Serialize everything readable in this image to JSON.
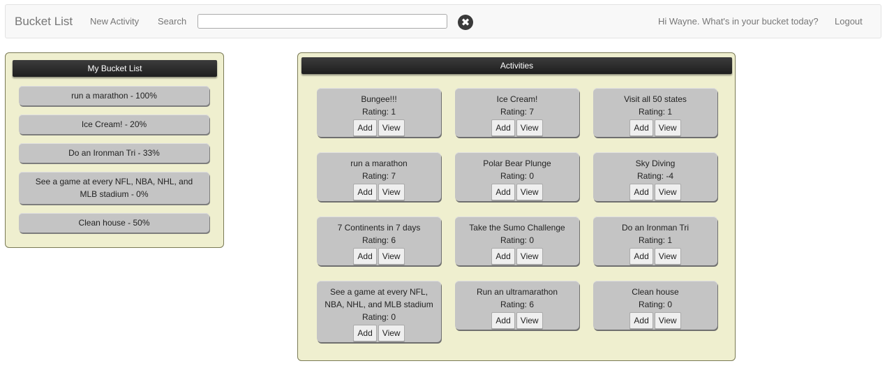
{
  "navbar": {
    "brand": "Bucket List",
    "new_activity": "New Activity",
    "search_label": "Search",
    "search_value": "",
    "clear_symbol": "✖",
    "greeting": "Hi Wayne. What's in your bucket today?",
    "logout": "Logout"
  },
  "bucket_list": {
    "title": "My Bucket List",
    "items": [
      "run a marathon - 100%",
      "Ice Cream! - 20%",
      "Do an Ironman Tri - 33%",
      "See a game at every NFL, NBA, NHL, and MLB stadium - 0%",
      "Clean house - 50%"
    ]
  },
  "activities": {
    "title": "Activities",
    "add_label": "Add",
    "view_label": "View",
    "items": [
      {
        "name": "Bungee!!!",
        "rating": "Rating: 1"
      },
      {
        "name": "Ice Cream!",
        "rating": "Rating: 7"
      },
      {
        "name": "Visit all 50 states",
        "rating": "Rating: 1"
      },
      {
        "name": "run a marathon",
        "rating": "Rating: 7"
      },
      {
        "name": "Polar Bear Plunge",
        "rating": "Rating: 0"
      },
      {
        "name": "Sky Diving",
        "rating": "Rating: -4"
      },
      {
        "name": "7 Continents in 7 days",
        "rating": "Rating: 6"
      },
      {
        "name": "Take the Sumo Challenge",
        "rating": "Rating: 0"
      },
      {
        "name": "Do an Ironman Tri",
        "rating": "Rating: 1"
      },
      {
        "name": "See a game at every NFL, NBA, NHL, and MLB stadium",
        "rating": "Rating: 0"
      },
      {
        "name": "Run an ultramarathon",
        "rating": "Rating: 6"
      },
      {
        "name": "Clean house",
        "rating": "Rating: 0"
      }
    ]
  }
}
